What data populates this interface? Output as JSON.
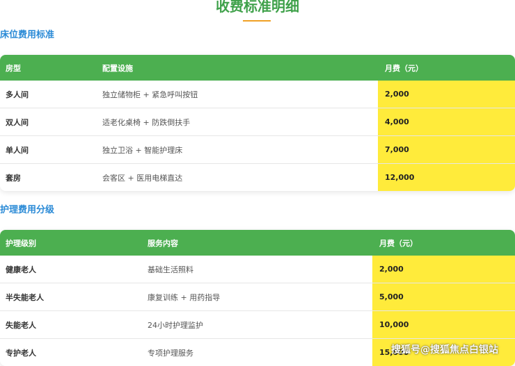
{
  "page_title": "收费标准明细",
  "bed_section": {
    "title": "床位费用标准",
    "headers": [
      "房型",
      "配置设施",
      "月费（元）"
    ],
    "rows": [
      [
        "多人间",
        "独立储物柜 + 紧急呼叫按钮",
        "2,000"
      ],
      [
        "双人间",
        "适老化桌椅 + 防跌倒扶手",
        "4,000"
      ],
      [
        "单人间",
        "独立卫浴 + 智能护理床",
        "7,000"
      ],
      [
        "套房",
        "会客区 + 医用电梯直达",
        "12,000"
      ]
    ]
  },
  "care_section": {
    "title": "护理费用分级",
    "headers": [
      "护理级别",
      "服务内容",
      "月费（元）"
    ],
    "rows": [
      [
        "健康老人",
        "基础生活照料",
        "2,000"
      ],
      [
        "半失能老人",
        "康复训练 + 用药指导",
        "5,000"
      ],
      [
        "失能老人",
        "24小时护理监护",
        "10,000"
      ],
      [
        "专护老人",
        "专项护理服务",
        "15,000"
      ]
    ]
  },
  "watermark": "搜狐号@搜狐焦点白银站",
  "colors": {
    "title_green": "#3fa14a",
    "header_green": "#4caf50",
    "section_blue": "#2a8ad6",
    "fee_highlight": "#ffeb3b",
    "underline_orange": "#f0a024"
  }
}
